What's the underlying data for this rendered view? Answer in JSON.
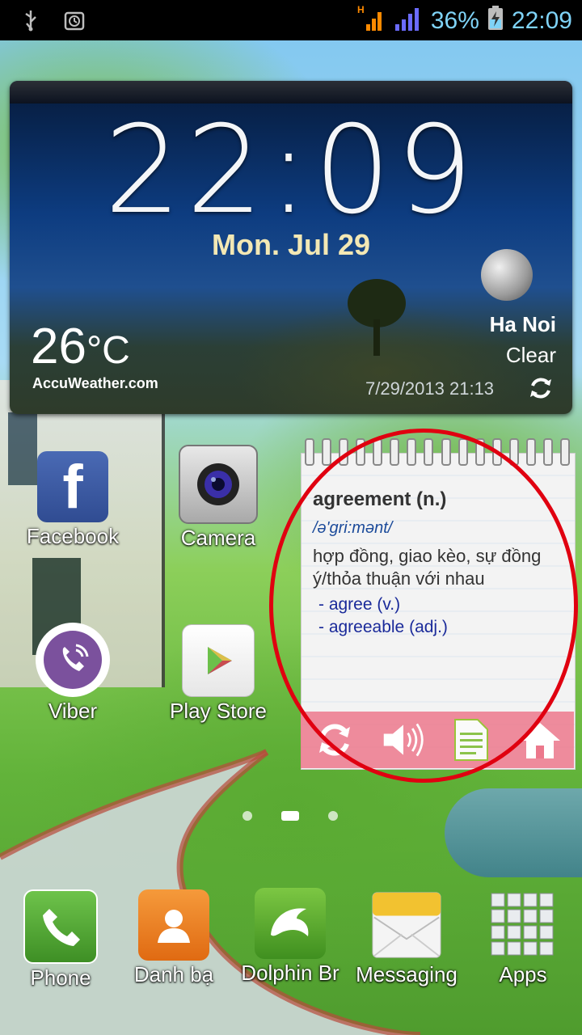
{
  "status_bar": {
    "battery_percent": "36%",
    "time": "22:09",
    "left_icons": [
      "usb-icon",
      "alarm-icon"
    ],
    "right_icons": [
      "hspa-signal-icon",
      "cell-signal-icon",
      "battery-charging-icon"
    ]
  },
  "clock_widget": {
    "time": "22:09",
    "date": "Mon. Jul 29",
    "temperature": "26",
    "temperature_unit": "°C",
    "provider": "AccuWeather.com",
    "city": "Ha Noi",
    "condition": "Clear",
    "updated": "7/29/2013 21:13"
  },
  "apps": [
    {
      "label": "Facebook",
      "icon": "facebook-icon"
    },
    {
      "label": "Camera",
      "icon": "camera-icon"
    },
    {
      "label": "Viber",
      "icon": "viber-icon"
    },
    {
      "label": "Play Store",
      "icon": "play-store-icon"
    }
  ],
  "dictionary_widget": {
    "word": "agreement (n.)",
    "phonetic": "/ə'gri:mənt/",
    "meaning": "hợp đồng, giao kèo, sự đồng ý/thỏa thuận với nhau",
    "related": [
      "- agree (v.)",
      "- agreeable (adj.)"
    ],
    "buttons": [
      "refresh-icon",
      "speaker-icon",
      "note-icon",
      "home-icon"
    ]
  },
  "page_indicator": {
    "count": 3,
    "active": 1
  },
  "dock": [
    {
      "label": "Phone",
      "icon": "phone-icon"
    },
    {
      "label": "Danh bạ",
      "icon": "contacts-icon"
    },
    {
      "label": "Dolphin Br",
      "icon": "dolphin-browser-icon"
    },
    {
      "label": "Messaging",
      "icon": "messaging-icon"
    },
    {
      "label": "Apps",
      "icon": "apps-grid-icon"
    }
  ],
  "colors": {
    "status_text": "#7fd3f7",
    "highlight_circle": "#e00010",
    "dict_bar": "#ec788c"
  }
}
